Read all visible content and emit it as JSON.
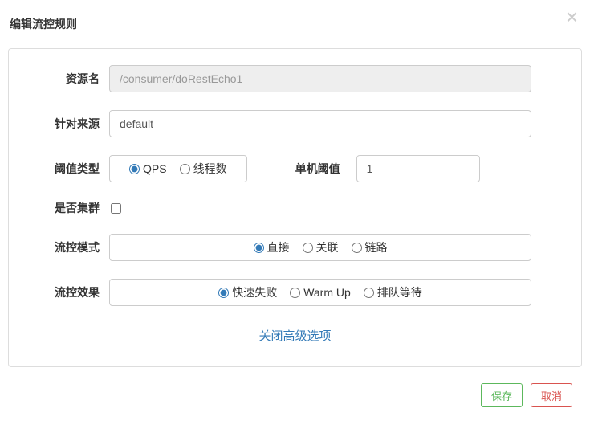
{
  "dialog": {
    "title": "编辑流控规则"
  },
  "form": {
    "labels": {
      "resource": "资源名",
      "source": "针对来源",
      "thresholdType": "阈值类型",
      "singleThreshold": "单机阈值",
      "cluster": "是否集群",
      "mode": "流控模式",
      "effect": "流控效果"
    },
    "resourceValue": "/consumer/doRestEcho1",
    "sourceValue": "default",
    "thresholdType": {
      "qps": "QPS",
      "thread": "线程数"
    },
    "singleThresholdValue": "1",
    "mode": {
      "direct": "直接",
      "relate": "关联",
      "chain": "链路"
    },
    "effect": {
      "failfast": "快速失败",
      "warmup": "Warm Up",
      "queue": "排队等待"
    }
  },
  "adv": {
    "toggleLabel": "关闭高级选项"
  },
  "footer": {
    "save": "保存",
    "cancel": "取消"
  }
}
